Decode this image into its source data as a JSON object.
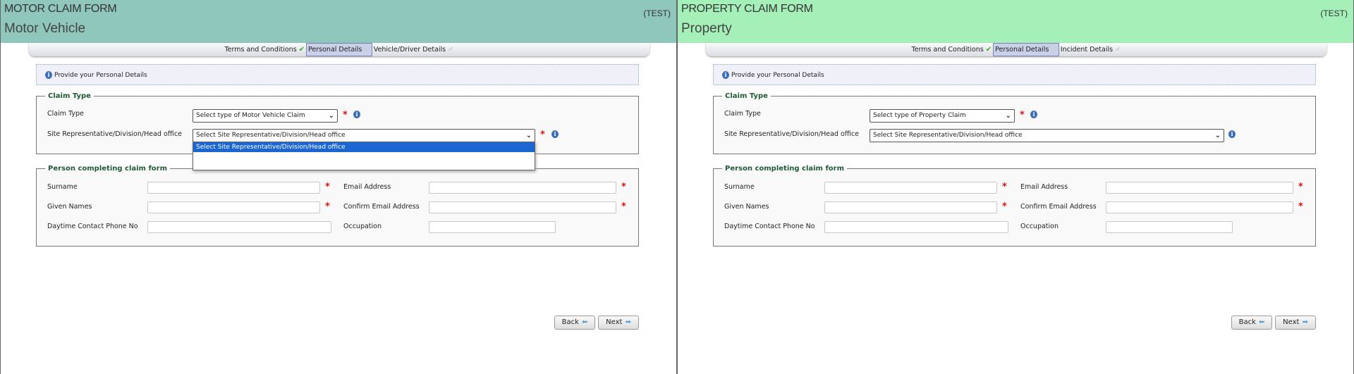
{
  "panels": [
    {
      "header_color": "#8fc7bd",
      "title": "MOTOR CLAIM FORM",
      "subtitle": "Motor Vehicle",
      "env": "(TEST)",
      "steps": [
        {
          "label": "Terms and Conditions",
          "status": "complete"
        },
        {
          "label": "Personal Details",
          "status": "active"
        },
        {
          "label": "Vehicle/Driver Details",
          "status": "pending"
        }
      ],
      "info": "Provide your Personal Details",
      "claim_type_legend": "Claim Type",
      "claim_type_label": "Claim Type",
      "claim_type_value": "Select type of Motor Vehicle Claim",
      "site_label": "Site Representative/Division/Head office",
      "site_value": "Select Site Representative/Division/Head office",
      "site_required": true,
      "site_dropdown_open": true,
      "site_options": [
        "Select Site Representative/Division/Head office"
      ],
      "person_legend": "Person completing claim form",
      "fields": {
        "surname": "Surname",
        "given": "Given Names",
        "phone": "Daytime Contact Phone No",
        "email": "Email Address",
        "confirm_email": "Confirm Email Address",
        "occupation": "Occupation"
      },
      "back": "Back",
      "next": "Next"
    },
    {
      "header_color": "#a5f0b9",
      "title": "PROPERTY CLAIM FORM",
      "subtitle": "Property",
      "env": "(TEST)",
      "steps": [
        {
          "label": "Terms and Conditions",
          "status": "complete"
        },
        {
          "label": "Personal Details",
          "status": "active"
        },
        {
          "label": "Incident Details",
          "status": "pending"
        }
      ],
      "info": "Provide your Personal Details",
      "claim_type_legend": "Claim Type",
      "claim_type_label": "Claim Type",
      "claim_type_value": "Select type of Property Claim",
      "site_label": "Site Representative/Division/Head office",
      "site_value": "Select Site Representative/Division/Head office",
      "site_required": false,
      "site_dropdown_open": false,
      "site_options": [],
      "person_legend": "Person completing claim form",
      "fields": {
        "surname": "Surname",
        "given": "Given Names",
        "phone": "Daytime Contact Phone No",
        "email": "Email Address",
        "confirm_email": "Confirm Email Address",
        "occupation": "Occupation"
      },
      "back": "Back",
      "next": "Next"
    }
  ]
}
